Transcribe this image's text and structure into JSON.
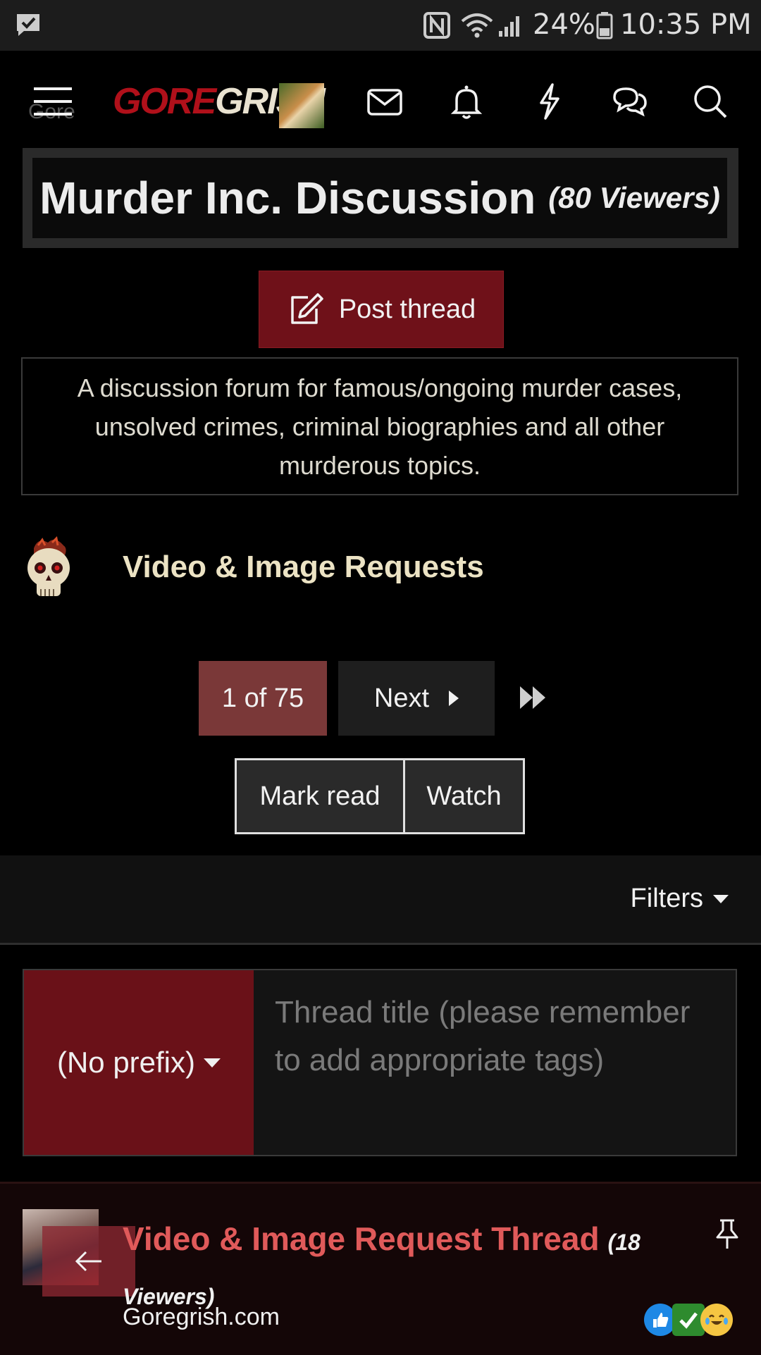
{
  "status_bar": {
    "battery_percent": "24%",
    "time": "10:35 PM"
  },
  "navbar": {
    "logo_part1": "GORE",
    "logo_part2": "GRISH",
    "ghost_breadcrumb": "Gore"
  },
  "forum": {
    "title": "Murder Inc. Discussion",
    "viewers": "(80 Viewers)",
    "post_thread_label": "Post thread",
    "description": "A discussion forum for famous/ongoing murder cases, unsolved crimes, criminal biographies and all other murderous topics."
  },
  "subforum": {
    "label": "Video & Image Requests"
  },
  "pagination": {
    "current": "1 of 75",
    "next_label": "Next"
  },
  "actions": {
    "mark_read": "Mark read",
    "watch": "Watch"
  },
  "filters": {
    "label": "Filters"
  },
  "quick_thread": {
    "prefix": "(No prefix)",
    "placeholder": "Thread title (please remember to add appropriate tags)"
  },
  "thread": {
    "title": "Video & Image Request Thread",
    "viewers": "(18 Viewers)",
    "forum": "Goregrish.com"
  },
  "colors": {
    "accent_red": "#6f1119",
    "title_red": "#e05a5a",
    "cream": "#ece3c4"
  }
}
